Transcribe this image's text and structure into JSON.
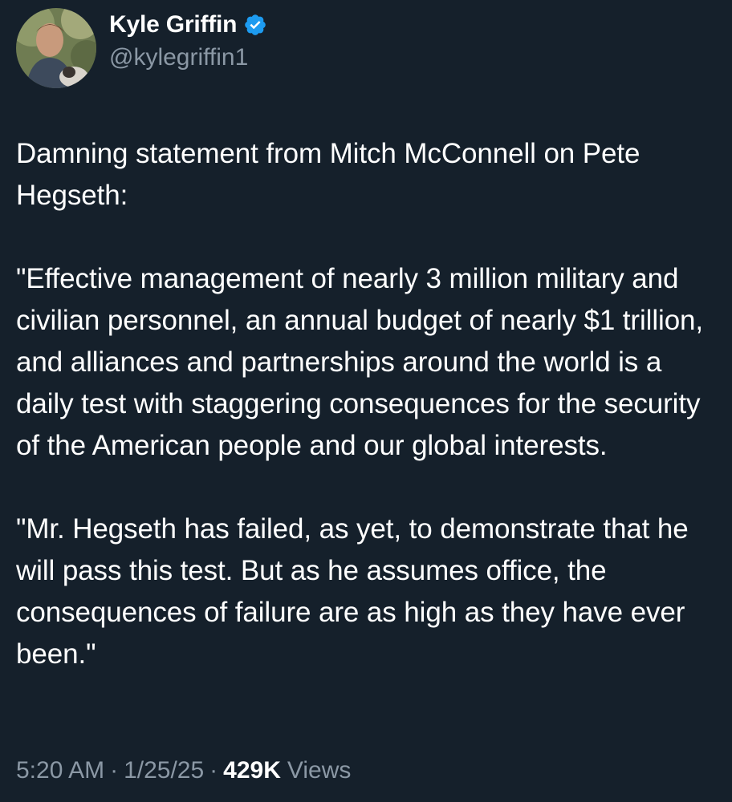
{
  "author": {
    "display_name": "Kyle Griffin",
    "handle": "@kylegriffin1",
    "verified_icon": "verified-badge-icon",
    "verified_color": "#1d9bf0"
  },
  "tweet": {
    "paragraphs": [
      "Damning statement from Mitch McConnell on Pete Hegseth:",
      "\"Effective management of nearly 3 million military and civilian personnel, an annual budget of nearly $1 trillion, and alliances and partnerships around the world is a daily test with staggering consequences for the security of the American people and our global interests.",
      "\"Mr. Hegseth has failed, as yet, to demonstrate that he will pass this test. But as he assumes office, the consequences of failure are as high as they have ever been.\""
    ]
  },
  "meta": {
    "time": "5:20 AM",
    "separator": "·",
    "date": "1/25/25",
    "views_count": "429K",
    "views_label": "Views"
  },
  "colors": {
    "background": "#15202b",
    "primary_text": "#ffffff",
    "secondary_text": "#8b98a5"
  }
}
